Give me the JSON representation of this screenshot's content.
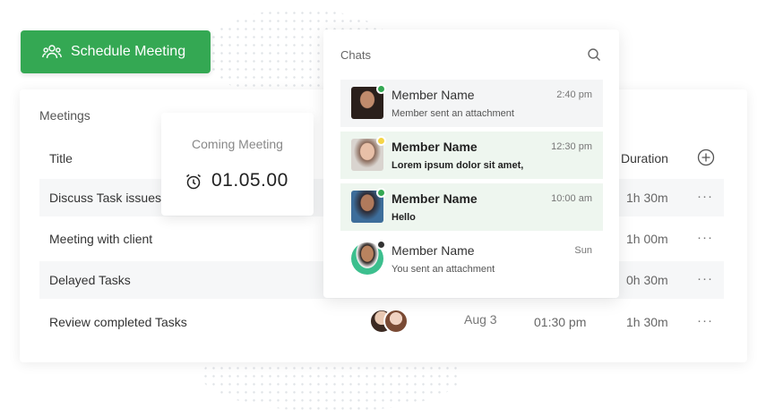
{
  "schedule_button": {
    "label": "Schedule Meeting"
  },
  "meetings": {
    "heading": "Meetings",
    "columns": {
      "title": "Title",
      "duration": "Duration"
    },
    "rows": [
      {
        "title": "Discuss Task issues",
        "duration": "1h 30m"
      },
      {
        "title": "Meeting with client",
        "duration": "1h 00m"
      },
      {
        "title": "Delayed Tasks",
        "duration": "0h 30m"
      },
      {
        "title": "Review completed Tasks",
        "date": "Aug 3",
        "time": "01:30 pm",
        "duration": "1h 30m"
      }
    ],
    "more_label": "···"
  },
  "coming_meeting": {
    "label": "Coming Meeting",
    "time": "01.05.00"
  },
  "chats": {
    "heading": "Chats",
    "items": [
      {
        "name": "Member Name",
        "message": "Member sent an attachment",
        "time": "2:40 pm",
        "status_color": "#34a853",
        "unread": false
      },
      {
        "name": "Member Name",
        "message": "Lorem ipsum dolor sit amet,",
        "time": "12:30 pm",
        "status_color": "#f5d547",
        "unread": true
      },
      {
        "name": "Member Name",
        "message": "Hello",
        "time": "10:00 am",
        "status_color": "#34a853",
        "unread": true
      },
      {
        "name": "Member Name",
        "message": "You sent an attachment",
        "time": "Sun",
        "status_color": "#333333",
        "unread": false
      }
    ]
  },
  "colors": {
    "accent": "#34a853"
  }
}
